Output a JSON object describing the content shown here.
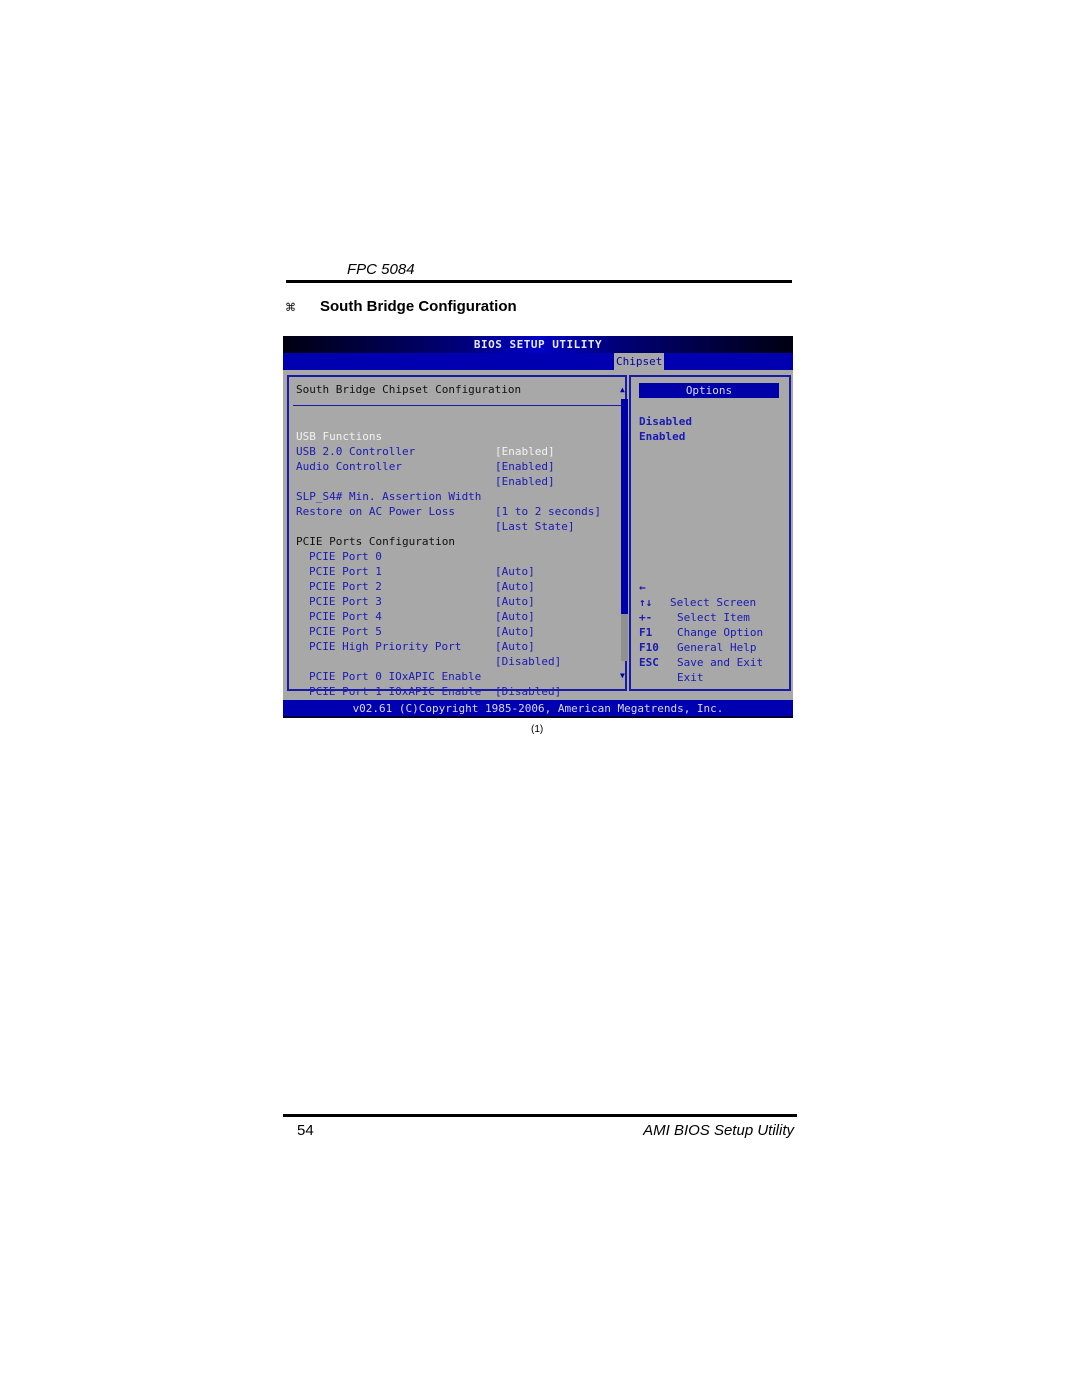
{
  "document": {
    "header_title": "FPC 5084",
    "section_bullet": "⌘",
    "section_title": "South Bridge Configuration",
    "figure_caption": "(1)",
    "page_number": "54",
    "footer_title": "AMI BIOS Setup Utility"
  },
  "bios": {
    "title": "BIOS SETUP UTILITY",
    "active_tab": "Chipset",
    "panel_heading": "South Bridge Chipset Configuration",
    "items": [
      {
        "label": "USB Functions",
        "value": "[Enabled]",
        "selected": true
      },
      {
        "label": "USB 2.0 Controller",
        "value": "[Enabled]"
      },
      {
        "label": "Audio Controller",
        "value": "[Enabled]"
      },
      {
        "label": "SLP_S4# Min. Assertion Width",
        "value": "[1 to 2 seconds]"
      },
      {
        "label": "Restore on AC Power Loss",
        "value": "[Last State]"
      },
      {
        "label": "PCIE Ports Configuration",
        "value": ""
      },
      {
        "label": "PCIE Port 0",
        "value": "[Auto]"
      },
      {
        "label": "PCIE Port 1",
        "value": "[Auto]"
      },
      {
        "label": "PCIE Port 2",
        "value": "[Auto]"
      },
      {
        "label": "PCIE Port 3",
        "value": "[Auto]"
      },
      {
        "label": "PCIE Port 4",
        "value": "[Auto]"
      },
      {
        "label": "PCIE Port 5",
        "value": "[Auto]"
      },
      {
        "label": "PCIE High Priority Port",
        "value": "[Disabled]"
      },
      {
        "label": "PCIE Port 0 IOxAPIC Enable",
        "value": "[Disabled]"
      },
      {
        "label": "PCIE Port 1 IOxAPIC Enable",
        "value": "[Disabled]"
      }
    ],
    "scroll_position": 0.82,
    "options": {
      "header": "Options",
      "items": [
        "Disabled",
        "Enabled"
      ]
    },
    "key_help": [
      {
        "key": "←",
        "desc": "Select Screen"
      },
      {
        "key": "↑↓",
        "desc": "Select Item"
      },
      {
        "key": "+-",
        "desc": "Change Option"
      },
      {
        "key": "F1",
        "desc": "General Help"
      },
      {
        "key": "F10",
        "desc": "Save and Exit"
      },
      {
        "key": "ESC",
        "desc": "Exit"
      }
    ],
    "footer": "v02.61 (C)Copyright 1985-2006, American Megatrends, Inc.",
    "colors": {
      "background": "#a8a8a8",
      "accent_blue": "#0000a8",
      "text_blue": "#1a1ab4",
      "selected_text": "#f2f2f2"
    }
  }
}
